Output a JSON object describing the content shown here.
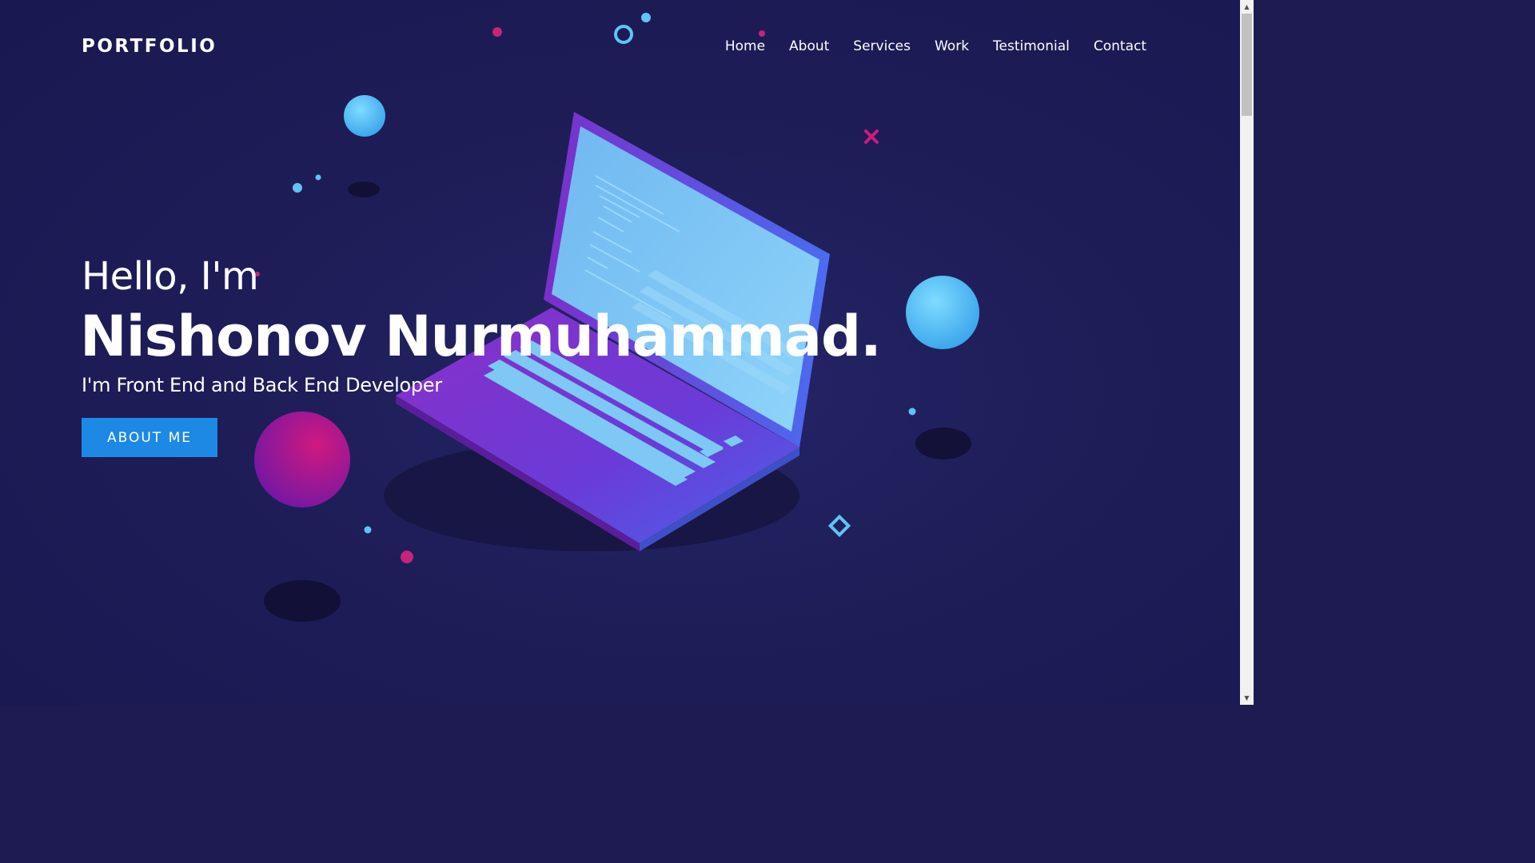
{
  "brand": {
    "logo_text": "PORTFOLIO"
  },
  "nav": {
    "items": [
      {
        "label": "Home"
      },
      {
        "label": "About"
      },
      {
        "label": "Services"
      },
      {
        "label": "Work"
      },
      {
        "label": "Testimonial"
      },
      {
        "label": "Contact"
      }
    ]
  },
  "hero": {
    "greeting": "Hello, I'm",
    "name": "Nishonov Nurmuhammad.",
    "role": "I'm Front End and Back End Developer",
    "cta_label": "ABOUT ME"
  },
  "colors": {
    "background": "#1d1b52",
    "accent": "#1e88e5",
    "text": "#ffffff"
  },
  "icons": {
    "scroll_up": "▲",
    "scroll_down": "▼"
  }
}
